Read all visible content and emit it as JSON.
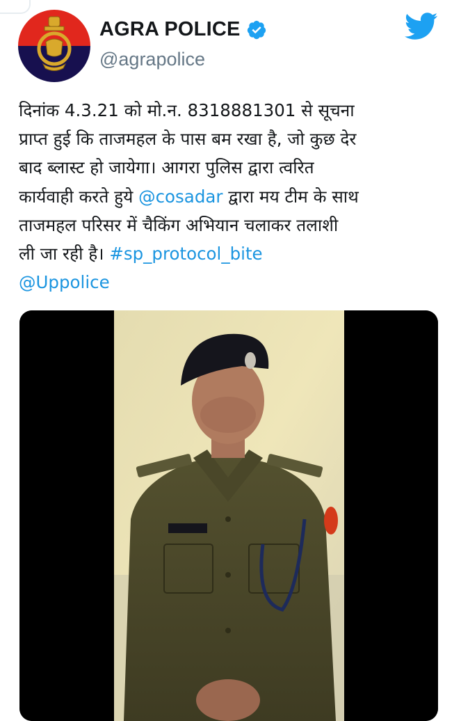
{
  "tweet": {
    "display_name": "AGRA POLICE",
    "handle": "@agrapolice",
    "text_lines": [
      {
        "parts": [
          {
            "t": "दिनांक 4.3.21 को मो.न. 8318881301 से सूचना"
          }
        ]
      },
      {
        "parts": [
          {
            "t": "प्राप्त हुई कि ताजमहल के पास बम रखा है, जो कुछ देर"
          }
        ]
      },
      {
        "parts": [
          {
            "t": "बाद ब्लास्ट हो जायेगा। आगरा पुलिस द्वारा त्वरित"
          }
        ]
      },
      {
        "parts": [
          {
            "t": "कार्यवाही करते हुये "
          },
          {
            "t": "@cosadar",
            "link": true
          },
          {
            "t": " द्वारा मय टीम के साथ"
          }
        ]
      },
      {
        "parts": [
          {
            "t": "ताजमहल परिसर में चैकिंग अभियान चलाकर तलाशी"
          }
        ]
      },
      {
        "parts": [
          {
            "t": "ली जा रही है। "
          },
          {
            "t": "#sp_protocol_bite",
            "link": true
          }
        ]
      },
      {
        "parts": [
          {
            "t": "@Uppolice",
            "link": true
          }
        ]
      }
    ]
  },
  "icons": {
    "avatar": "uttar-pradesh-police-emblem",
    "verified": "verified-badge-icon",
    "brand": "twitter-bird-icon"
  },
  "colors": {
    "link": "#1b95e0",
    "verified": "#1da1f2",
    "twitter_blue": "#1da1f2",
    "avatar_top": "#e1271d",
    "avatar_bottom": "#17104f",
    "text": "#14171a",
    "handle": "#657786"
  }
}
